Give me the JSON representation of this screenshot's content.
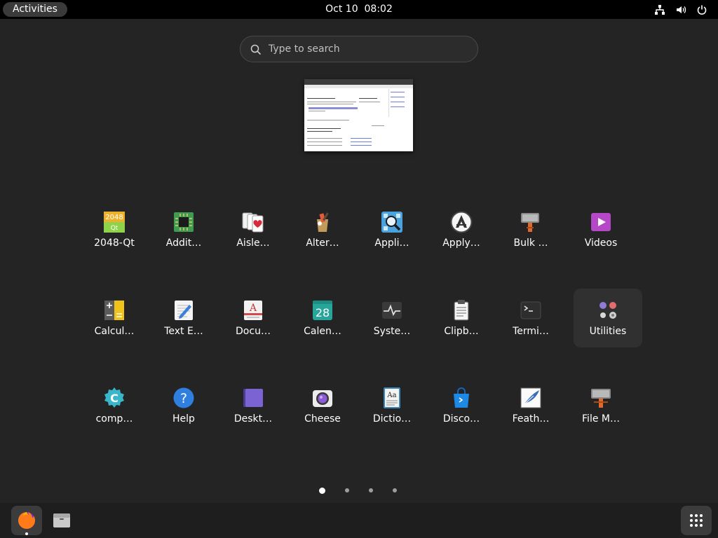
{
  "topbar": {
    "activities_label": "Activities",
    "clock": "Oct 10  08:02",
    "tray_icons": [
      "network-icon",
      "volume-icon",
      "power-icon"
    ]
  },
  "search": {
    "placeholder": "Type to search",
    "value": ""
  },
  "apps": [
    {
      "label": "2048-Qt",
      "icon": "2048-icon"
    },
    {
      "label": "Addit…",
      "icon": "additional-drivers-icon"
    },
    {
      "label": "Aisle…",
      "icon": "cards-icon"
    },
    {
      "label": "Alter…",
      "icon": "alternatives-icon"
    },
    {
      "label": "Appli…",
      "icon": "app-search-icon"
    },
    {
      "label": "Apply…",
      "icon": "apply-icon"
    },
    {
      "label": "Bulk …",
      "icon": "bulk-rename-icon"
    },
    {
      "label": "Videos",
      "icon": "videos-icon"
    },
    {
      "label": "Calcul…",
      "icon": "calculator-icon"
    },
    {
      "label": "Text E…",
      "icon": "text-editor-icon"
    },
    {
      "label": "Docu…",
      "icon": "document-viewer-icon"
    },
    {
      "label": "Calen…",
      "icon": "calendar-icon",
      "day": "28"
    },
    {
      "label": "Syste…",
      "icon": "system-monitor-icon"
    },
    {
      "label": "Clipb…",
      "icon": "clipboard-icon"
    },
    {
      "label": "Termi…",
      "icon": "terminal-icon"
    },
    {
      "label": "Utilities",
      "icon": "utilities-folder-icon"
    },
    {
      "label": "comp…",
      "icon": "compiz-icon"
    },
    {
      "label": "Help",
      "icon": "help-icon"
    },
    {
      "label": "Deskt…",
      "icon": "desktop-icon"
    },
    {
      "label": "Cheese",
      "icon": "cheese-icon"
    },
    {
      "label": "Dictio…",
      "icon": "dictionary-icon"
    },
    {
      "label": "Disco…",
      "icon": "discover-icon"
    },
    {
      "label": "Feath…",
      "icon": "feather-icon"
    },
    {
      "label": "File M…",
      "icon": "file-manager-icon"
    }
  ],
  "pages": {
    "count": 4,
    "current": 1
  },
  "dock": {
    "items": [
      {
        "name": "firefox",
        "icon": "firefox-icon",
        "running": true
      },
      {
        "name": "files",
        "icon": "files-icon",
        "running": false
      }
    ],
    "show_apps_icon": "app-grid-icon"
  },
  "colors": {
    "background": "#242424",
    "topbar": "#000000",
    "dock": "#1e1e1e",
    "accent": "#e95420"
  }
}
